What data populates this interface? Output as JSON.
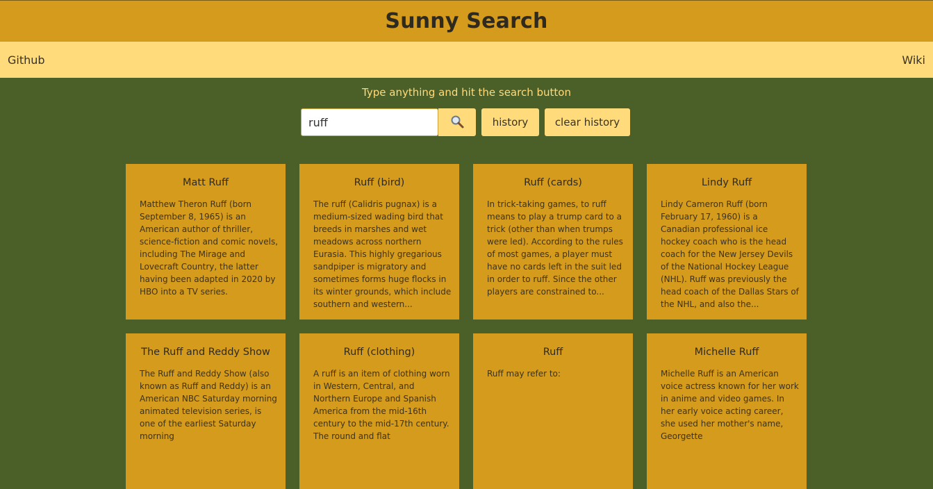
{
  "header": {
    "title": "Sunny Search"
  },
  "nav": {
    "left_link": "Github",
    "right_link": "Wiki"
  },
  "search": {
    "hint": "Type anything and hit the search button",
    "value": "ruff",
    "history_label": "history",
    "clear_label": "clear history"
  },
  "results": [
    {
      "title": "Matt Ruff",
      "snippet": "Matthew Theron Ruff (born September 8, 1965) is an American author of thriller, science-fiction and comic novels, including The Mirage and Lovecraft Country, the latter having been adapted in 2020 by HBO into a TV series."
    },
    {
      "title": "Ruff (bird)",
      "snippet": "The ruff (Calidris pugnax) is a medium-sized wading bird that breeds in marshes and wet meadows across northern Eurasia. This highly gregarious sandpiper is migratory and sometimes forms huge flocks in its winter grounds, which include southern and western..."
    },
    {
      "title": "Ruff (cards)",
      "snippet": "In trick-taking games, to ruff means to play a trump card to a trick (other than when trumps were led). According to the rules of most games, a player must have no cards left in the suit led in order to ruff. Since the other players are constrained to..."
    },
    {
      "title": "Lindy Ruff",
      "snippet": "Lindy Cameron Ruff (born February 17, 1960) is a Canadian professional ice hockey coach who is the head coach for the New Jersey Devils of the National Hockey League (NHL). Ruff was previously the head coach of the Dallas Stars of the NHL, and also the..."
    },
    {
      "title": "The Ruff and Reddy Show",
      "snippet": "The Ruff and Reddy Show (also known as Ruff and Reddy) is an American NBC Saturday morning animated television series, is one of the earliest Saturday morning"
    },
    {
      "title": "Ruff (clothing)",
      "snippet": "A ruff is an item of clothing worn in Western, Central, and Northern Europe and Spanish America from the mid-16th century to the mid-17th century. The round and flat"
    },
    {
      "title": "Ruff",
      "snippet": "Ruff may refer to:"
    },
    {
      "title": "Michelle Ruff",
      "snippet": "Michelle Ruff is an American voice actress known for her work in anime and video games. In her early voice acting career, she used her mother's name, Georgette"
    }
  ]
}
